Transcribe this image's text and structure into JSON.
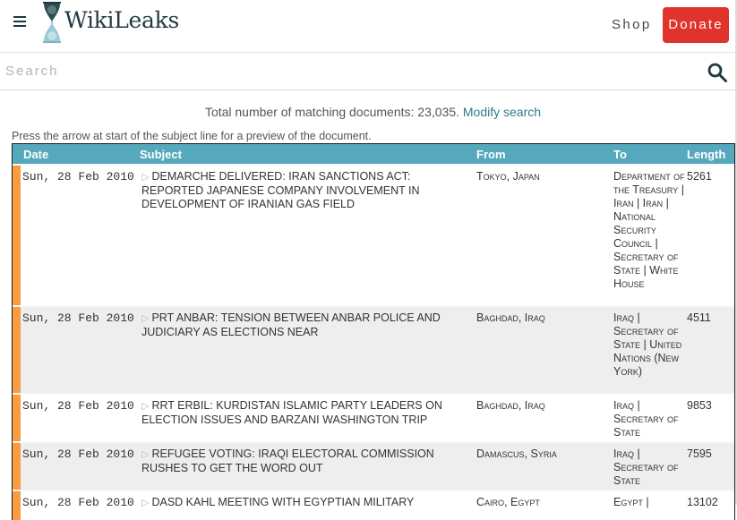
{
  "header": {
    "brand": "WikiLeaks",
    "shop_label": "Shop",
    "donate_label": "Donate",
    "donate_color": "#e0332b"
  },
  "search": {
    "placeholder": "Search",
    "value": ""
  },
  "results": {
    "total_text": "Total number of matching documents: 23,035.",
    "modify_link": "Modify search",
    "hint": "Press the arrow at start of the subject line for a preview of the document."
  },
  "table": {
    "header_color": "#56a8bd",
    "accent_color": "#fb9b3f",
    "columns": [
      "Date",
      "Subject",
      "From",
      "To",
      "Length"
    ],
    "rows": [
      {
        "date": "Sun, 28 Feb 2010",
        "subject": "DEMARCHE DELIVERED: IRAN SANCTIONS ACT: REPORTED JAPANESE COMPANY INVOLVEMENT IN DEVELOPMENT OF IRANIAN GAS FIELD",
        "from": "Tokyo, Japan",
        "to": "Department of the Treasury | Iran | Iran | National Security Council | Secretary of State | White House",
        "length": "5261"
      },
      {
        "date": "Sun, 28 Feb 2010",
        "subject": "PRT ANBAR: TENSION BETWEEN ANBAR POLICE AND JUDICIARY AS ELECTIONS NEAR",
        "from": "Baghdad, Iraq",
        "to": "Iraq | Secretary of State | United Nations (New York)",
        "length": "4511"
      },
      {
        "date": "Sun, 28 Feb 2010",
        "subject": "RRT ERBIL: KURDISTAN ISLAMIC PARTY LEADERS ON ELECTION ISSUES AND BARZANI WASHINGTON TRIP",
        "from": "Baghdad, Iraq",
        "to": "Iraq | Secretary of State",
        "length": "9853"
      },
      {
        "date": "Sun, 28 Feb 2010",
        "subject": "REFUGEE VOTING: IRAQI ELECTORAL COMMISSION RUSHES TO GET THE WORD OUT",
        "from": "Damascus, Syria",
        "to": "Iraq | Secretary of State",
        "length": "7595"
      },
      {
        "date": "Sun, 28 Feb 2010",
        "subject": "DASD KAHL MEETING WITH EGYPTIAN MILITARY",
        "from": "Cairo, Egypt",
        "to": "Egypt |",
        "length": "13102"
      }
    ]
  },
  "icons": {
    "menu": "hamburger-menu-icon",
    "logo": "wikileaks-hourglass-logo",
    "search": "magnifier-search-icon",
    "preview": "triangle-right-arrow-icon"
  }
}
